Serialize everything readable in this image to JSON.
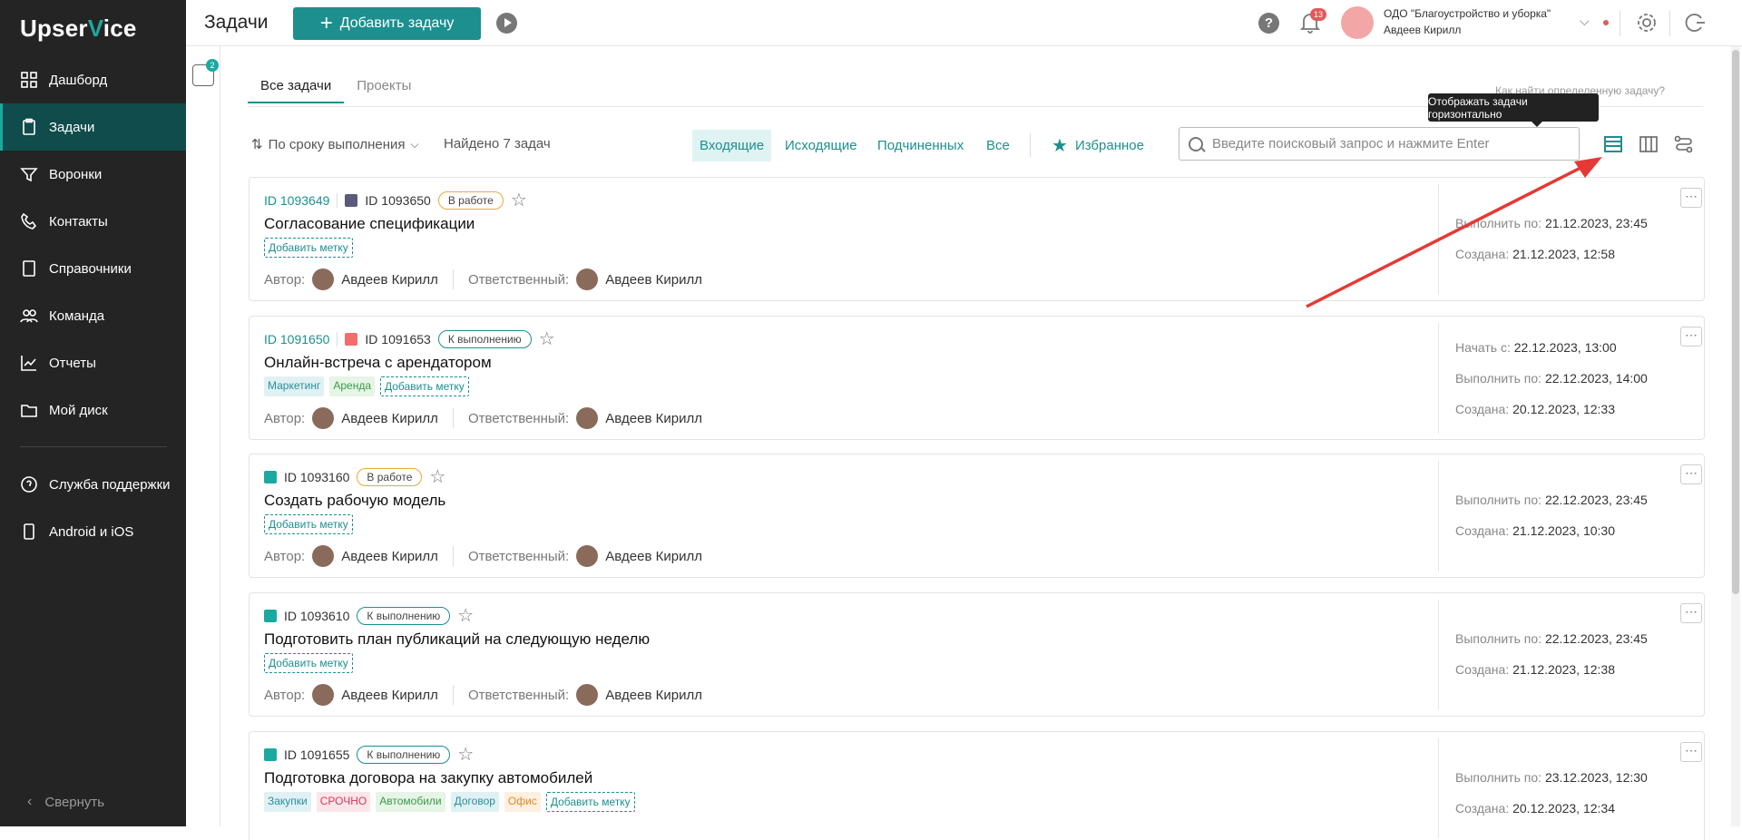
{
  "app": {
    "logo_a": "Upser",
    "logo_v": "V",
    "logo_b": "ice"
  },
  "sidebar": {
    "items": [
      {
        "label": "Дашборд",
        "icon": "dashboard-icon"
      },
      {
        "label": "Задачи",
        "icon": "tasks-icon"
      },
      {
        "label": "Воронки",
        "icon": "funnel-icon"
      },
      {
        "label": "Контакты",
        "icon": "phone-icon"
      },
      {
        "label": "Справочники",
        "icon": "book-icon"
      },
      {
        "label": "Команда",
        "icon": "team-icon"
      },
      {
        "label": "Отчеты",
        "icon": "chart-icon"
      },
      {
        "label": "Мой диск",
        "icon": "folder-icon"
      }
    ],
    "support": "Служба поддержки",
    "mobile": "Android и iOS",
    "collapse": "Свернуть",
    "filter_count": "2"
  },
  "header": {
    "title": "Задачи",
    "add_label": "Добавить задачу",
    "notif_count": "13",
    "org": "ОДО \"Благоустройство и уборка\"",
    "user": "Авдеев Кирилл"
  },
  "tabs": [
    "Все задачи",
    "Проекты"
  ],
  "hint": "Как найти определенную задачу?",
  "tooltip": "Отображать задачи горизонтально",
  "toolbar": {
    "sort": "По сроку выполнения",
    "found": "Найдено 7 задач",
    "filters": [
      "Входящие",
      "Исходящие",
      "Подчиненных",
      "Все"
    ],
    "favorites": "Избранное",
    "search_placeholder": "Введите поисковый запрос и нажмите Enter"
  },
  "labels": {
    "author": "Автор:",
    "responsible": "Ответственный:",
    "add_tag": "Добавить метку",
    "start": "Начать с:",
    "due": "Выполнить по:",
    "created": "Создана:"
  },
  "tasks": [
    {
      "parent": "ID 1093649",
      "id": "ID 1093650",
      "status": "В работе",
      "title": "Согласование спецификации",
      "author": "Авдеев Кирилл",
      "responsible": "Авдеев Кирилл",
      "due": "21.12.2023, 23:45",
      "created": "21.12.2023, 12:58"
    },
    {
      "parent": "ID 1091650",
      "id": "ID 1091653",
      "status": "К выполнению",
      "title": "Онлайн-встреча с арендатором",
      "tags": [
        "Маркетинг",
        "Аренда"
      ],
      "author": "Авдеев Кирилл",
      "responsible": "Авдеев Кирилл",
      "start": "22.12.2023, 13:00",
      "due": "22.12.2023, 14:00",
      "created": "20.12.2023, 12:33"
    },
    {
      "id": "ID 1093160",
      "status": "В работе",
      "title": "Создать рабочую модель",
      "author": "Авдеев Кирилл",
      "responsible": "Авдеев Кирилл",
      "due": "22.12.2023, 23:45",
      "created": "21.12.2023, 10:30"
    },
    {
      "id": "ID 1093610",
      "status": "К выполнению",
      "title": "Подготовить план публикаций на следующую неделю",
      "author": "Авдеев Кирилл",
      "responsible": "Авдеев Кирилл",
      "due": "22.12.2023, 23:45",
      "created": "21.12.2023, 12:38"
    },
    {
      "id": "ID 1091655",
      "status": "К выполнению",
      "title": "Подготовка договора на закупку автомобилей",
      "tags": [
        "Закупки",
        "СРОЧНО",
        "Автомобили",
        "Договор",
        "Офис"
      ],
      "due": "23.12.2023, 12:30",
      "created": "20.12.2023, 12:34"
    }
  ],
  "colors": {
    "accent": "#1d8f8f",
    "sidebar_bg": "#242424",
    "active_bg": "#0f4c4b",
    "arrow": "#e53935"
  }
}
